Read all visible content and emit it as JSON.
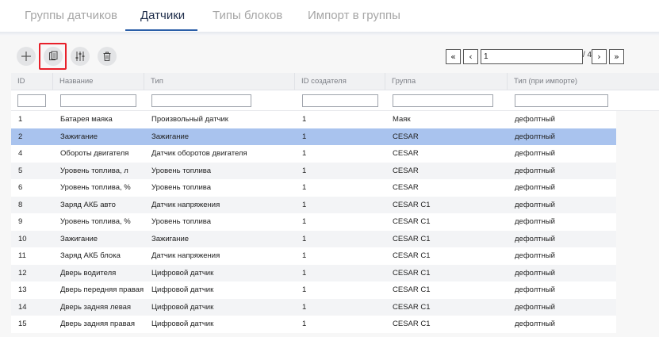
{
  "tabs": [
    {
      "label": "Группы датчиков"
    },
    {
      "label": "Датчики"
    },
    {
      "label": "Типы блоков"
    },
    {
      "label": "Импорт в группы"
    }
  ],
  "toolbar": {
    "add_icon": "plus-icon",
    "copy_icon": "copy-document-icon",
    "settings_icon": "sliders-icon",
    "delete_icon": "trash-icon"
  },
  "pagination": {
    "first_glyph": "«",
    "prev_glyph": "‹",
    "current_page": "1",
    "total": "/ 4",
    "next_glyph": "›",
    "last_glyph": "»"
  },
  "columns": [
    "ID",
    "Название",
    "Тип",
    "ID создателя",
    "Группа",
    "Тип (при импорте)"
  ],
  "rows": [
    {
      "id": "1",
      "name": "Батарея маяка",
      "type": "Произвольный датчик",
      "creator": "1",
      "group": "Маяк",
      "import_type": "дефолтный"
    },
    {
      "id": "2",
      "name": "Зажигание",
      "type": "Зажигание",
      "creator": "1",
      "group": "CESAR",
      "import_type": "дефолтный"
    },
    {
      "id": "4",
      "name": "Обороты двигателя",
      "type": "Датчик оборотов двигателя",
      "creator": "1",
      "group": "CESAR",
      "import_type": "дефолтный"
    },
    {
      "id": "5",
      "name": "Уровень топлива, л",
      "type": "Уровень топлива",
      "creator": "1",
      "group": "CESAR",
      "import_type": "дефолтный"
    },
    {
      "id": "6",
      "name": "Уровень топлива, %",
      "type": "Уровень топлива",
      "creator": "1",
      "group": "CESAR",
      "import_type": "дефолтный"
    },
    {
      "id": "8",
      "name": "Заряд АКБ авто",
      "type": "Датчик напряжения",
      "creator": "1",
      "group": "CESAR C1",
      "import_type": "дефолтный"
    },
    {
      "id": "9",
      "name": "Уровень топлива, %",
      "type": "Уровень топлива",
      "creator": "1",
      "group": "CESAR C1",
      "import_type": "дефолтный"
    },
    {
      "id": "10",
      "name": "Зажигание",
      "type": "Зажигание",
      "creator": "1",
      "group": "CESAR C1",
      "import_type": "дефолтный"
    },
    {
      "id": "11",
      "name": "Заряд АКБ блока",
      "type": "Датчик напряжения",
      "creator": "1",
      "group": "CESAR C1",
      "import_type": "дефолтный"
    },
    {
      "id": "12",
      "name": "Дверь водителя",
      "type": "Цифровой датчик",
      "creator": "1",
      "group": "CESAR C1",
      "import_type": "дефолтный"
    },
    {
      "id": "13",
      "name": "Дверь передняя правая",
      "type": "Цифровой датчик",
      "creator": "1",
      "group": "CESAR C1",
      "import_type": "дефолтный"
    },
    {
      "id": "14",
      "name": "Дверь задняя левая",
      "type": "Цифровой датчик",
      "creator": "1",
      "group": "CESAR C1",
      "import_type": "дефолтный"
    },
    {
      "id": "15",
      "name": "Дверь задняя правая",
      "type": "Цифровой датчик",
      "creator": "1",
      "group": "CESAR C1",
      "import_type": "дефолтный"
    }
  ],
  "selected_row_id": "2",
  "colors": {
    "accent": "#2b5fa8",
    "selected_row": "#a9c3ee",
    "highlight_border": "#e8202a"
  }
}
